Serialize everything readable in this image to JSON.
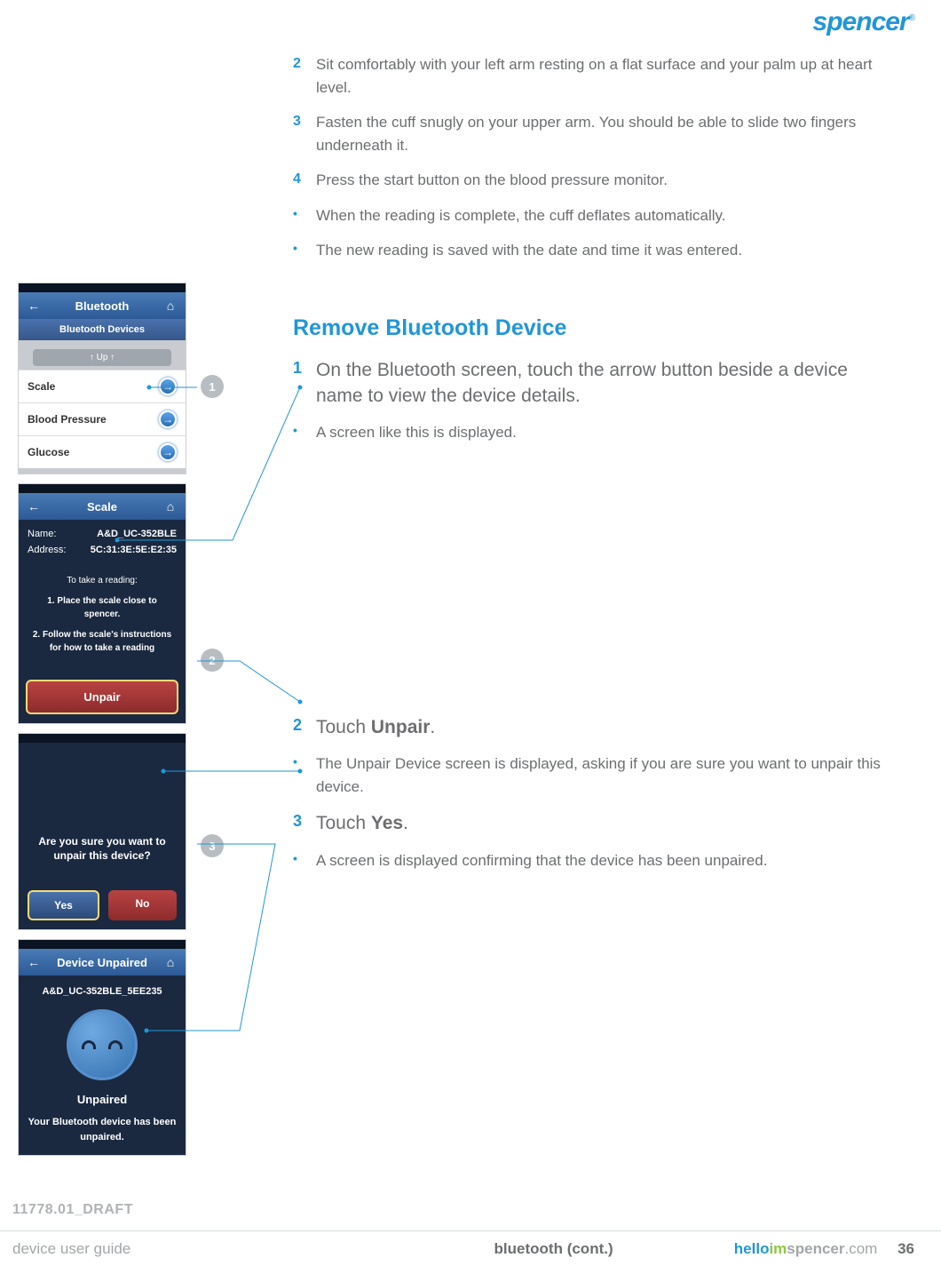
{
  "brand": "spencer",
  "top_steps": [
    {
      "n": "2",
      "t": "Sit comfortably with your left arm resting on a flat surface and your palm up at heart level."
    },
    {
      "n": "3",
      "t": "Fasten the cuff snugly on your upper arm. You should be able to slide two fingers underneath it."
    },
    {
      "n": "4",
      "t": "Press the start button on the blood pressure monitor."
    }
  ],
  "top_bullets": [
    "When the reading is complete, the cuff deflates automatically.",
    "The new reading is saved with the date and time it was entered."
  ],
  "section_title": "Remove Bluetooth Device",
  "sec_steps": {
    "step1_n": "1",
    "step1_t": "On the Bluetooth screen, touch the arrow button beside a device name to view the device details.",
    "bullet1": "A screen like this is displayed.",
    "step2_n": "2",
    "step2_pre": "Touch ",
    "step2_bold": "Unpair",
    "step2_post": ".",
    "bullet2": "The Unpair Device screen is displayed, asking if you are sure you want to unpair this device.",
    "step3_n": "3",
    "step3_pre": "Touch ",
    "step3_bold": "Yes",
    "step3_post": ".",
    "bullet3": "A screen is displayed confirming that the device has been unpaired."
  },
  "screen1": {
    "title": "Bluetooth",
    "header": "Bluetooth Devices",
    "up": "↑  Up  ↑",
    "rows": [
      "Scale",
      "Blood Pressure",
      "Glucose"
    ]
  },
  "screen2": {
    "title": "Scale",
    "name_label": "Name:",
    "name_val": "A&D_UC-352BLE",
    "addr_label": "Address:",
    "addr_val": "5C:31:3E:5E:E2:35",
    "instr_head": "To take a reading:",
    "instr1": "1. Place the scale close to spencer.",
    "instr2": "2. Follow the scale's instructions for how to take a reading",
    "unpair": "Unpair"
  },
  "screen3": {
    "question": "Are you sure you want to unpair this device?",
    "yes": "Yes",
    "no": "No"
  },
  "screen4": {
    "title": "Device Unpaired",
    "name": "A&D_UC-352BLE_5EE235",
    "status": "Unpaired",
    "msg": "Your Bluetooth device has been unpaired."
  },
  "callouts": {
    "c1": "1",
    "c2": "2",
    "c3": "3"
  },
  "draft": "11778.01_DRAFT",
  "footer": {
    "left": "device user guide",
    "center": "bluetooth (cont.)",
    "hello": "hello",
    "im": "im",
    "spencer": "spencer",
    "com": ".com",
    "page": "36"
  }
}
